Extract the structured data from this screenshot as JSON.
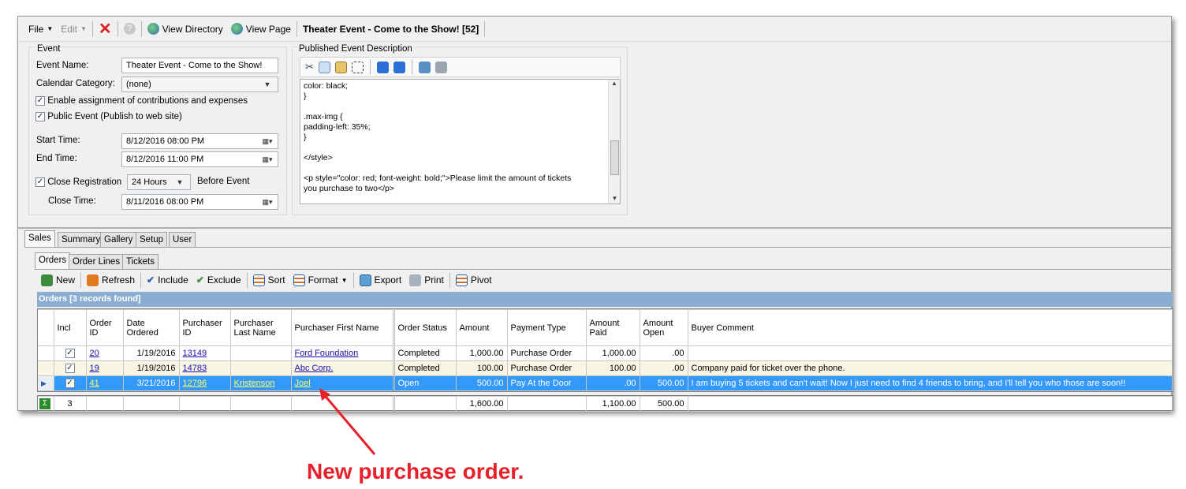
{
  "toolbar": {
    "file": "File",
    "edit": "Edit",
    "view_directory": "View Directory",
    "view_page": "View Page",
    "window_title": "Theater Event - Come to the Show! [52]"
  },
  "event": {
    "group_label": "Event",
    "name_label": "Event Name:",
    "name_value": "Theater Event - Come to the Show!",
    "category_label": "Calendar Category:",
    "category_value": "(none)",
    "enable_contrib": "Enable assignment of contributions and expenses",
    "public_event": "Public Event (Publish to web site)",
    "start_label": "Start Time:",
    "start_value": "8/12/2016 08:00 PM",
    "end_label": "End Time:",
    "end_value": "8/12/2016 11:00 PM",
    "close_reg_label": "Close Registration",
    "close_reg_value": "24 Hours",
    "before_event": "Before Event",
    "close_time_label": "Close Time:",
    "close_time_value": "8/11/2016 08:00 PM"
  },
  "description": {
    "label": "Published Event Description",
    "code": "color: black;\n}\n\n.max-img {\npadding-left: 35%;\n}\n\n</style>\n\n<p style=\"color: red; font-weight: bold;\">Please limit the amount of tickets\nyou purchase to two</p>"
  },
  "tabs": [
    "Sales",
    "Summary",
    "Gallery",
    "Setup",
    "User"
  ],
  "subtabs": [
    "Orders",
    "Order Lines",
    "Tickets"
  ],
  "grid_toolbar": {
    "new": "New",
    "refresh": "Refresh",
    "include": "Include",
    "exclude": "Exclude",
    "sort": "Sort",
    "format": "Format",
    "export": "Export",
    "print": "Print",
    "pivot": "Pivot"
  },
  "grid": {
    "caption": "Orders [3 records found]",
    "columns": [
      "Incl",
      "Order ID",
      "Date Ordered",
      "Purchaser ID",
      "Purchaser Last Name",
      "Purchaser First Name",
      "Order Status",
      "Amount",
      "Payment Type",
      "Amount Paid",
      "Amount Open",
      "Buyer Comment"
    ],
    "rows": [
      {
        "order_id": "20",
        "date": "1/19/2016",
        "purchaser_id": "13149",
        "last": "",
        "first": "Ford Foundation",
        "status": "Completed",
        "amount": "1,000.00",
        "payment": "Purchase Order",
        "paid": "1,000.00",
        "open": ".00",
        "comment": ""
      },
      {
        "order_id": "19",
        "date": "1/19/2016",
        "purchaser_id": "14783",
        "last": "",
        "first": "Abc Corp.",
        "status": "Completed",
        "amount": "100.00",
        "payment": "Purchase Order",
        "paid": "100.00",
        "open": ".00",
        "comment": "Company paid for ticket over the phone."
      },
      {
        "order_id": "41",
        "date": "3/21/2016",
        "purchaser_id": "12796",
        "last": "Kristenson",
        "first": "Joel",
        "status": "Open",
        "amount": "500.00",
        "payment": "Pay At the Door",
        "paid": ".00",
        "open": "500.00",
        "comment": "I am buying 5 tickets and can't wait!  Now I just need to find 4 friends to bring, and I'll tell you who those are soon!!"
      }
    ],
    "footer": {
      "count": "3",
      "amount": "1,600.00",
      "paid": "1,100.00",
      "open": "500.00"
    }
  },
  "annotation": "New purchase order.",
  "colors": {
    "accent": "#3399ff",
    "caption_bg": "#8aaed2",
    "annotation": "#e8202a"
  }
}
